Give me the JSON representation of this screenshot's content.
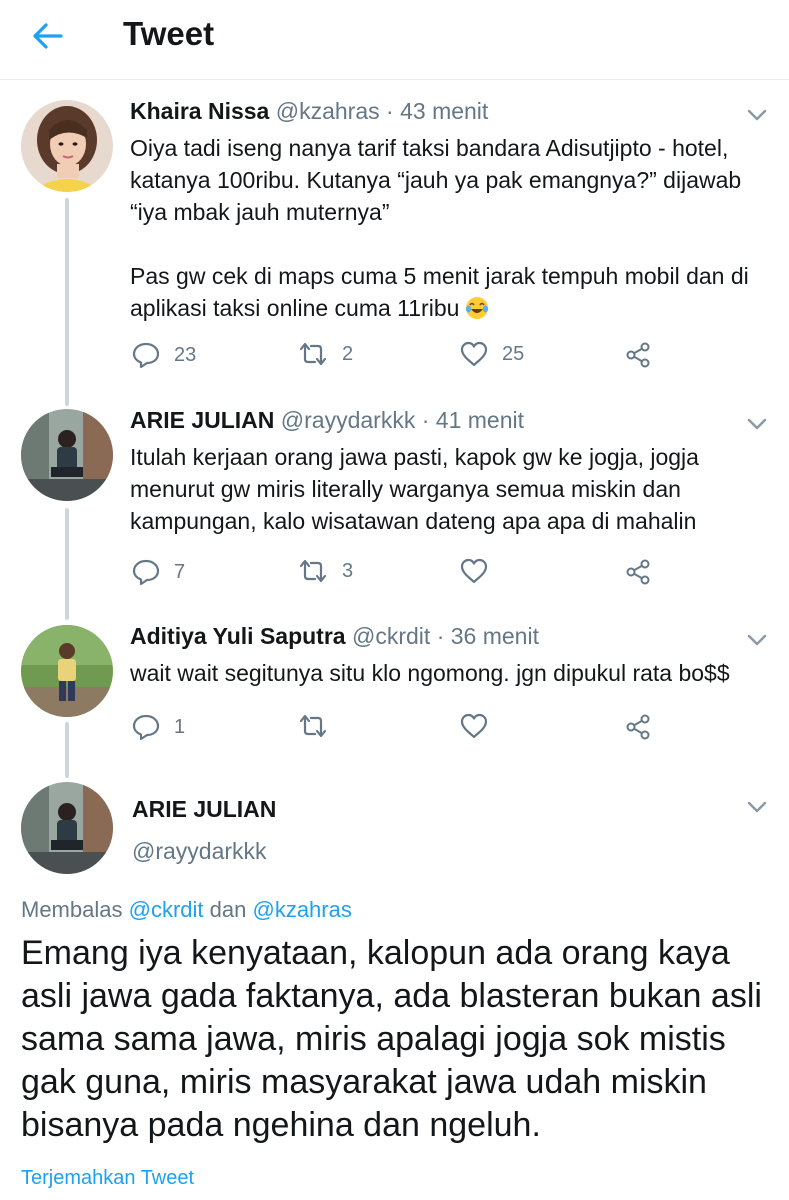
{
  "header": {
    "title": "Tweet"
  },
  "replies": [
    {
      "name": "Khaira Nissa",
      "handle": "@kzahras",
      "time": "43 menit",
      "paragraphs": [
        "Oiya tadi iseng nanya tarif taksi bandara Adisutjipto - hotel, katanya 100ribu. Kutanya “jauh ya pak emangnya?” dijawab “iya mbak jauh muternya”",
        "Pas gw cek di maps cuma 5 menit jarak tempuh mobil dan di aplikasi taksi online cuma 11ribu"
      ],
      "emoji": "tears-of-joy-emoji",
      "replies_count": "23",
      "retweets_count": "2",
      "likes_count": "25"
    },
    {
      "name": "ARIE JULIAN",
      "handle": "@rayydarkkk",
      "time": "41 menit",
      "paragraphs": [
        "Itulah kerjaan orang jawa pasti, kapok gw ke jogja, jogja menurut gw miris literally warganya semua miskin dan kampungan, kalo wisatawan dateng apa apa di mahalin"
      ],
      "replies_count": "7",
      "retweets_count": "3",
      "likes_count": ""
    },
    {
      "name": "Aditiya Yuli Saputra",
      "handle": "@ckrdit",
      "time": "36 menit",
      "paragraphs": [
        "wait wait segitunya situ klo ngomong. jgn dipukul rata bo$$"
      ],
      "replies_count": "1",
      "retweets_count": "",
      "likes_count": ""
    }
  ],
  "separator": "·",
  "main_tweet": {
    "name": "ARIE JULIAN",
    "handle": "@rayydarkkk",
    "reply_prefix": "Membalas",
    "reply_mention_1": "@ckrdit",
    "reply_joiner": "dan",
    "reply_mention_2": "@kzahras",
    "text": "Emang iya kenyataan, kalopun ada orang kaya asli jawa gada faktanya, ada blasteran bukan asli sama sama jawa, miris apalagi jogja sok mistis gak guna, miris masyarakat jawa udah miskin bisanya pada ngehina dan ngeluh.",
    "translate_label": "Terjemahkan Tweet"
  },
  "colors": {
    "accent": "#1da1f2",
    "secondary_text": "#657786",
    "primary_text": "#14171a",
    "divider": "#e6ecf0",
    "thread_line": "#ccd6dd"
  },
  "icons": {
    "back": "arrow-left-icon",
    "reply": "speech-bubble-icon",
    "retweet": "retweet-icon",
    "like": "heart-icon",
    "share": "share-icon",
    "menu": "chevron-down-icon"
  }
}
